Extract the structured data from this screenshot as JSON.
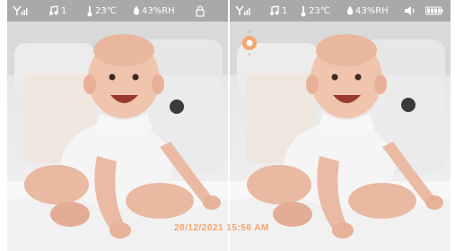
{
  "left": {
    "signal_bars": "Yıll",
    "music_count": "1",
    "temperature": "23℃",
    "humidity": "43%RH",
    "icons": [
      "signal-icon",
      "music-icon",
      "thermometer-icon",
      "droplet-icon",
      "lock-icon"
    ]
  },
  "right": {
    "signal_bars": "Yıll",
    "music_count": "1",
    "temperature": "23℃",
    "humidity": "43%RH",
    "icons": [
      "signal-icon",
      "music-icon",
      "thermometer-icon",
      "droplet-icon",
      "speaker-icon",
      "battery-icon",
      "record-indicator-icon"
    ]
  },
  "timestamp": "28/12/2021 15:56 AM",
  "colors": {
    "statusbar": "#a9a9a9",
    "accent": "#f6a56e"
  }
}
